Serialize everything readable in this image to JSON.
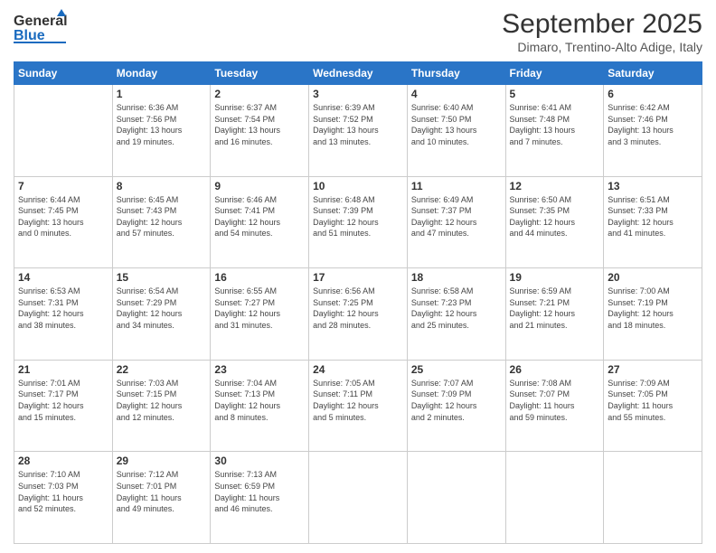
{
  "header": {
    "logo_general": "General",
    "logo_blue": "Blue",
    "month_title": "September 2025",
    "subtitle": "Dimaro, Trentino-Alto Adige, Italy"
  },
  "weekdays": [
    "Sunday",
    "Monday",
    "Tuesday",
    "Wednesday",
    "Thursday",
    "Friday",
    "Saturday"
  ],
  "weeks": [
    [
      {
        "day": "",
        "info": ""
      },
      {
        "day": "1",
        "info": "Sunrise: 6:36 AM\nSunset: 7:56 PM\nDaylight: 13 hours\nand 19 minutes."
      },
      {
        "day": "2",
        "info": "Sunrise: 6:37 AM\nSunset: 7:54 PM\nDaylight: 13 hours\nand 16 minutes."
      },
      {
        "day": "3",
        "info": "Sunrise: 6:39 AM\nSunset: 7:52 PM\nDaylight: 13 hours\nand 13 minutes."
      },
      {
        "day": "4",
        "info": "Sunrise: 6:40 AM\nSunset: 7:50 PM\nDaylight: 13 hours\nand 10 minutes."
      },
      {
        "day": "5",
        "info": "Sunrise: 6:41 AM\nSunset: 7:48 PM\nDaylight: 13 hours\nand 7 minutes."
      },
      {
        "day": "6",
        "info": "Sunrise: 6:42 AM\nSunset: 7:46 PM\nDaylight: 13 hours\nand 3 minutes."
      }
    ],
    [
      {
        "day": "7",
        "info": "Sunrise: 6:44 AM\nSunset: 7:45 PM\nDaylight: 13 hours\nand 0 minutes."
      },
      {
        "day": "8",
        "info": "Sunrise: 6:45 AM\nSunset: 7:43 PM\nDaylight: 12 hours\nand 57 minutes."
      },
      {
        "day": "9",
        "info": "Sunrise: 6:46 AM\nSunset: 7:41 PM\nDaylight: 12 hours\nand 54 minutes."
      },
      {
        "day": "10",
        "info": "Sunrise: 6:48 AM\nSunset: 7:39 PM\nDaylight: 12 hours\nand 51 minutes."
      },
      {
        "day": "11",
        "info": "Sunrise: 6:49 AM\nSunset: 7:37 PM\nDaylight: 12 hours\nand 47 minutes."
      },
      {
        "day": "12",
        "info": "Sunrise: 6:50 AM\nSunset: 7:35 PM\nDaylight: 12 hours\nand 44 minutes."
      },
      {
        "day": "13",
        "info": "Sunrise: 6:51 AM\nSunset: 7:33 PM\nDaylight: 12 hours\nand 41 minutes."
      }
    ],
    [
      {
        "day": "14",
        "info": "Sunrise: 6:53 AM\nSunset: 7:31 PM\nDaylight: 12 hours\nand 38 minutes."
      },
      {
        "day": "15",
        "info": "Sunrise: 6:54 AM\nSunset: 7:29 PM\nDaylight: 12 hours\nand 34 minutes."
      },
      {
        "day": "16",
        "info": "Sunrise: 6:55 AM\nSunset: 7:27 PM\nDaylight: 12 hours\nand 31 minutes."
      },
      {
        "day": "17",
        "info": "Sunrise: 6:56 AM\nSunset: 7:25 PM\nDaylight: 12 hours\nand 28 minutes."
      },
      {
        "day": "18",
        "info": "Sunrise: 6:58 AM\nSunset: 7:23 PM\nDaylight: 12 hours\nand 25 minutes."
      },
      {
        "day": "19",
        "info": "Sunrise: 6:59 AM\nSunset: 7:21 PM\nDaylight: 12 hours\nand 21 minutes."
      },
      {
        "day": "20",
        "info": "Sunrise: 7:00 AM\nSunset: 7:19 PM\nDaylight: 12 hours\nand 18 minutes."
      }
    ],
    [
      {
        "day": "21",
        "info": "Sunrise: 7:01 AM\nSunset: 7:17 PM\nDaylight: 12 hours\nand 15 minutes."
      },
      {
        "day": "22",
        "info": "Sunrise: 7:03 AM\nSunset: 7:15 PM\nDaylight: 12 hours\nand 12 minutes."
      },
      {
        "day": "23",
        "info": "Sunrise: 7:04 AM\nSunset: 7:13 PM\nDaylight: 12 hours\nand 8 minutes."
      },
      {
        "day": "24",
        "info": "Sunrise: 7:05 AM\nSunset: 7:11 PM\nDaylight: 12 hours\nand 5 minutes."
      },
      {
        "day": "25",
        "info": "Sunrise: 7:07 AM\nSunset: 7:09 PM\nDaylight: 12 hours\nand 2 minutes."
      },
      {
        "day": "26",
        "info": "Sunrise: 7:08 AM\nSunset: 7:07 PM\nDaylight: 11 hours\nand 59 minutes."
      },
      {
        "day": "27",
        "info": "Sunrise: 7:09 AM\nSunset: 7:05 PM\nDaylight: 11 hours\nand 55 minutes."
      }
    ],
    [
      {
        "day": "28",
        "info": "Sunrise: 7:10 AM\nSunset: 7:03 PM\nDaylight: 11 hours\nand 52 minutes."
      },
      {
        "day": "29",
        "info": "Sunrise: 7:12 AM\nSunset: 7:01 PM\nDaylight: 11 hours\nand 49 minutes."
      },
      {
        "day": "30",
        "info": "Sunrise: 7:13 AM\nSunset: 6:59 PM\nDaylight: 11 hours\nand 46 minutes."
      },
      {
        "day": "",
        "info": ""
      },
      {
        "day": "",
        "info": ""
      },
      {
        "day": "",
        "info": ""
      },
      {
        "day": "",
        "info": ""
      }
    ]
  ]
}
